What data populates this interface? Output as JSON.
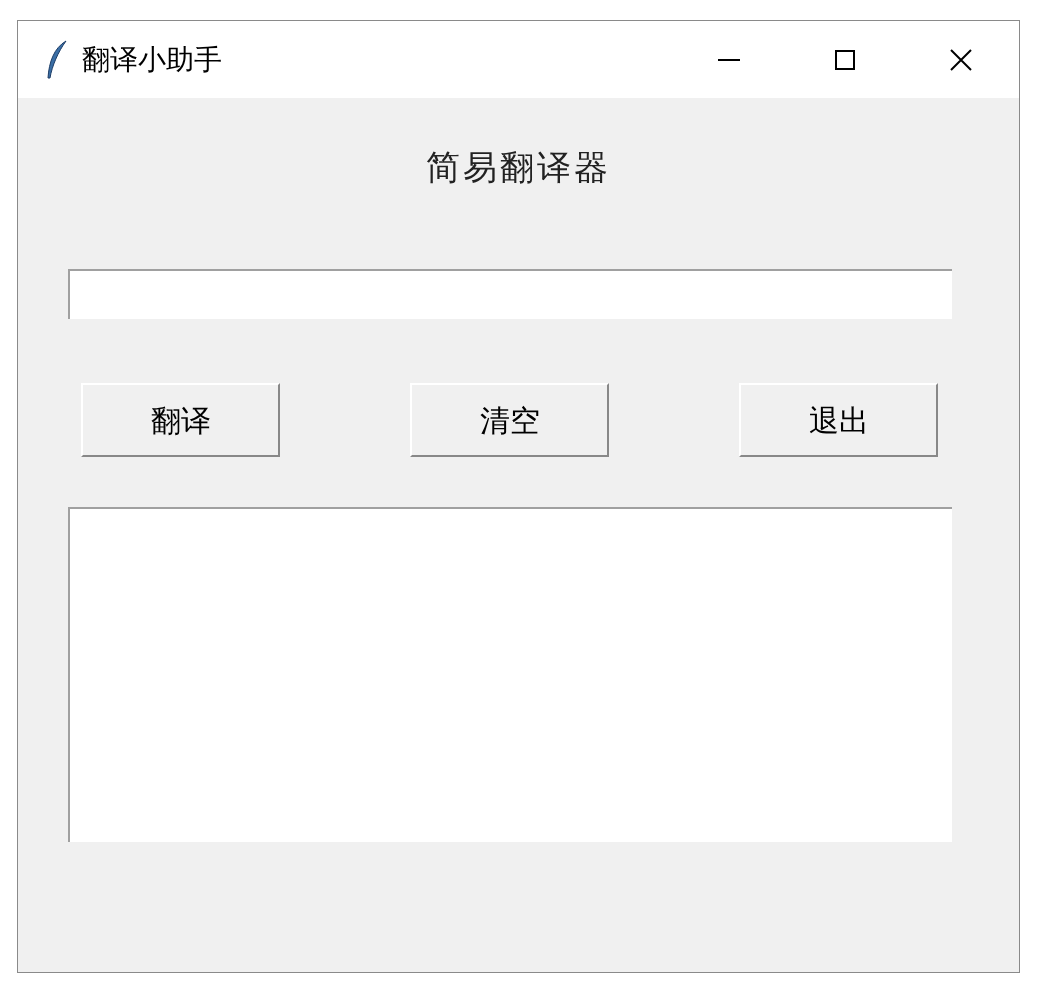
{
  "window": {
    "title": "翻译小助手"
  },
  "heading": "简易翻译器",
  "buttons": [
    "翻译",
    "清空",
    "退出"
  ]
}
